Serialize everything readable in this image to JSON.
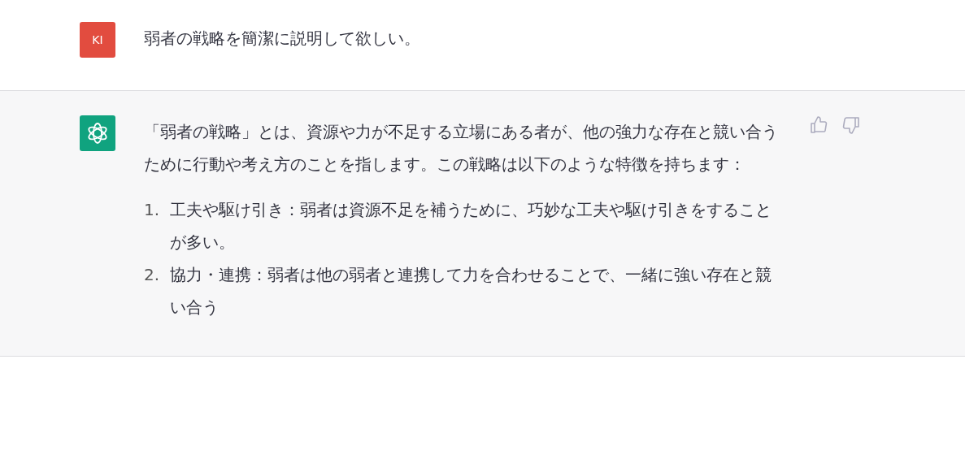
{
  "messages": [
    {
      "kind": "user",
      "avatar": "KI",
      "text": "弱者の戦略を簡潔に説明して欲しい。"
    },
    {
      "kind": "assistant",
      "text": "「弱者の戦略」とは、資源や力が不足する立場にある者が、他の強力な存在と競い合うために行動や考え方のことを指します。この戦略は以下のような特徴を持ちます：",
      "list": [
        {
          "number": "1.",
          "text": "工夫や駆け引き：弱者は資源不足を補うために、巧妙な工夫や駆け引きをすることが多い。"
        },
        {
          "number": "2.",
          "text": "協力・連携：弱者は他の弱者と連携して力を合わせることで、一緒に強い存在と競い合う"
        }
      ]
    }
  ]
}
